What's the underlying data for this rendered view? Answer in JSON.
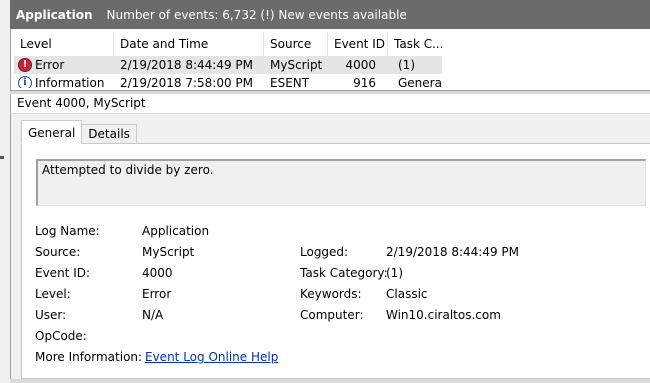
{
  "titlebar": {
    "app_name": "Application",
    "info": "Number of events: 6,732 (!) New events available"
  },
  "event_list": {
    "columns": [
      "Level",
      "Date and Time",
      "Source",
      "Event ID",
      "Task C..."
    ],
    "rows": [
      {
        "icon": "error-icon",
        "level": "Error",
        "date_time": "2/19/2018 8:44:49 PM",
        "source": "MyScript",
        "event_id": "4000",
        "task": "(1)"
      },
      {
        "icon": "information-icon",
        "level": "Information",
        "date_time": "2/19/2018 7:58:00 PM",
        "source": "ESENT",
        "event_id": "916",
        "task": "General"
      }
    ]
  },
  "detail": {
    "header": "Event 4000, MyScript",
    "tabs": [
      "General",
      "Details"
    ],
    "description": "Attempted to divide by zero.",
    "fields": {
      "log_name_label": "Log Name:",
      "log_name": "Application",
      "source_label": "Source:",
      "source": "MyScript",
      "logged_label": "Logged:",
      "logged": "2/19/2018 8:44:49 PM",
      "event_id_label": "Event ID:",
      "event_id": "4000",
      "task_category_label": "Task Category:",
      "task_category": "(1)",
      "level_label": "Level:",
      "level": "Error",
      "keywords_label": "Keywords:",
      "keywords": "Classic",
      "user_label": "User:",
      "user": "N/A",
      "computer_label": "Computer:",
      "computer": "Win10.ciraltos.com",
      "opcode_label": "OpCode:",
      "more_info_label": "More Information:",
      "more_info_link": "Event Log Online Help"
    }
  },
  "colors": {
    "titlebar_bg": "#6b6b6b",
    "selected_row": "#e5e5e5",
    "error_icon": "#c4273b",
    "link": "#0030c0"
  }
}
